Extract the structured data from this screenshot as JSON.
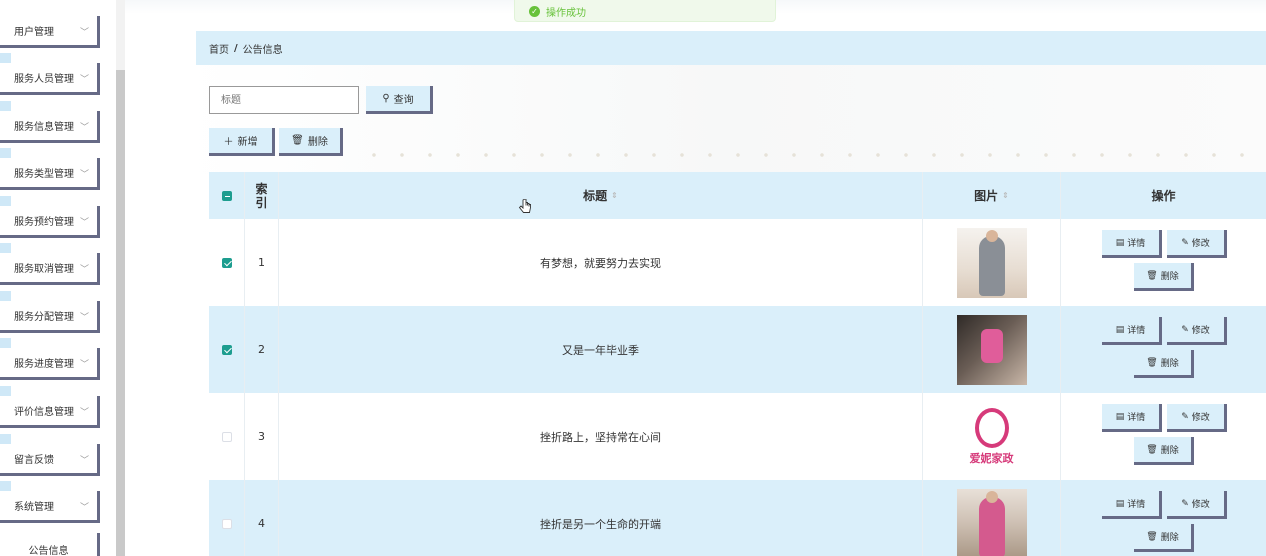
{
  "toast": {
    "text": "操作成功"
  },
  "sidebar": {
    "items": [
      {
        "label": "用户管理"
      },
      {
        "label": "服务人员管理"
      },
      {
        "label": "服务信息管理"
      },
      {
        "label": "服务类型管理"
      },
      {
        "label": "服务预约管理"
      },
      {
        "label": "服务取消管理"
      },
      {
        "label": "服务分配管理"
      },
      {
        "label": "服务进度管理"
      },
      {
        "label": "评价信息管理"
      },
      {
        "label": "留言反馈"
      },
      {
        "label": "系统管理"
      }
    ],
    "subitem": "公告信息"
  },
  "breadcrumb": {
    "home": "首页",
    "separator": "/",
    "current": "公告信息"
  },
  "search": {
    "placeholder": "标题",
    "query_label": "查询"
  },
  "actions": {
    "add_label": "新增",
    "delete_label": "删除"
  },
  "table": {
    "columns": {
      "index": "索引",
      "title": "标题",
      "image": "图片",
      "operation": "操作"
    },
    "rows": [
      {
        "index": "1",
        "title": "有梦想，就要努力去实现",
        "checked": true
      },
      {
        "index": "2",
        "title": "又是一年毕业季",
        "checked": true
      },
      {
        "index": "3",
        "title": "挫折路上，坚持常在心间",
        "checked": false,
        "logo_text": "爱妮家政"
      },
      {
        "index": "4",
        "title": "挫折是另一个生命的开端",
        "checked": false
      }
    ],
    "row_actions": {
      "detail": "详情",
      "edit": "修改",
      "remove": "删除"
    }
  },
  "colors": {
    "accent_light": "#daeffa",
    "border_dark": "#666a86",
    "check": "#1d9d8f",
    "success": "#67c23a"
  }
}
